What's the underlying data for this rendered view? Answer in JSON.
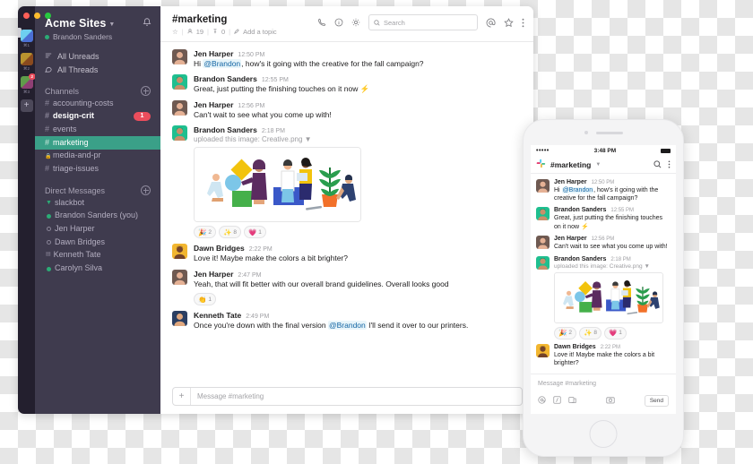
{
  "window": {
    "traffic_lights": [
      "close",
      "minimize",
      "maximize"
    ]
  },
  "rail": {
    "workspaces": [
      {
        "shortcut": "⌘1",
        "color_a": "#6ecff0",
        "color_b": "#4b6fd4",
        "badge": null
      },
      {
        "shortcut": "⌘2",
        "color_a": "#b9932f",
        "color_b": "#8a4a1e",
        "badge": null
      },
      {
        "shortcut": "⌘3",
        "color_a": "#5f9c4a",
        "color_b": "#8f3f74",
        "badge": "2"
      }
    ],
    "add_label": "+"
  },
  "sidebar": {
    "workspace_name": "Acme Sites",
    "user_name": "Brandon Sanders",
    "nav": [
      {
        "label": "All Unreads",
        "icon": "unreads-icon"
      },
      {
        "label": "All Threads",
        "icon": "threads-icon"
      }
    ],
    "channels_header": "Channels",
    "channels": [
      {
        "name": "accounting-costs",
        "symbol": "#",
        "state": "normal",
        "badge": null
      },
      {
        "name": "design-crit",
        "symbol": "#",
        "state": "unread",
        "badge": "1"
      },
      {
        "name": "events",
        "symbol": "#",
        "state": "normal",
        "badge": null
      },
      {
        "name": "marketing",
        "symbol": "#",
        "state": "active",
        "badge": null
      },
      {
        "name": "media-and-pr",
        "symbol": "🔒",
        "state": "normal",
        "badge": null
      },
      {
        "name": "triage-issues",
        "symbol": "#",
        "state": "normal",
        "badge": null
      }
    ],
    "dms_header": "Direct Messages",
    "dms": [
      {
        "name": "slackbot",
        "presence": "bot"
      },
      {
        "name": "Brandon Sanders (you)",
        "presence": "online"
      },
      {
        "name": "Jen Harper",
        "presence": "offline"
      },
      {
        "name": "Dawn Bridges",
        "presence": "offline"
      },
      {
        "name": "Kenneth Tate",
        "presence": "away"
      },
      {
        "name": "Carolyn Silva",
        "presence": "online"
      }
    ]
  },
  "channel_header": {
    "title": "#marketing",
    "star": "☆",
    "members_count": "19",
    "pins_count": "0",
    "add_topic": "Add a topic",
    "search_placeholder": "Search",
    "icons": [
      "phone-icon",
      "info-icon",
      "gear-icon",
      "mentions-icon",
      "star-icon",
      "more-icon"
    ]
  },
  "messages": [
    {
      "author": "Jen Harper",
      "time": "12:50 PM",
      "avatar": "jen",
      "text_pre": "Hi ",
      "mention": "@Brandon",
      "text_post": ", how's it going with the creative for the fall campaign?"
    },
    {
      "author": "Brandon Sanders",
      "time": "12:55 PM",
      "avatar": "brandon",
      "text_pre": "Great, just putting the finishing touches on it now ⚡",
      "mention": "",
      "text_post": ""
    },
    {
      "author": "Jen Harper",
      "time": "12:56 PM",
      "avatar": "jen",
      "text_pre": "Can't wait to see what you come up with!",
      "mention": "",
      "text_post": ""
    },
    {
      "author": "Brandon Sanders",
      "time": "2:18 PM",
      "avatar": "brandon",
      "upload_text": "uploaded this image: Creative.png",
      "attachment": "creative-illustration",
      "reactions": [
        {
          "emoji": "🎉",
          "count": "2"
        },
        {
          "emoji": "✨",
          "count": "8"
        },
        {
          "emoji": "💗",
          "count": "1"
        }
      ]
    },
    {
      "author": "Dawn Bridges",
      "time": "2:22 PM",
      "avatar": "dawn",
      "text_pre": "Love it! Maybe make the colors a bit brighter?",
      "mention": "",
      "text_post": ""
    },
    {
      "author": "Jen Harper",
      "time": "2:47 PM",
      "avatar": "jen",
      "text_pre": "Yeah, that will fit better with our overall brand guidelines. Overall looks good",
      "mention": "",
      "text_post": "",
      "reactions": [
        {
          "emoji": "👏",
          "count": "1"
        }
      ]
    },
    {
      "author": "Kenneth Tate",
      "time": "2:49 PM",
      "avatar": "kenneth",
      "text_pre": "Once you're down with the final version ",
      "mention": "@Brandon",
      "text_post": " I'll send it over to our printers."
    }
  ],
  "composer": {
    "placeholder": "Message #marketing",
    "add_label": "+"
  },
  "phone": {
    "status": {
      "signal": "•••••",
      "time": "3:48 PM",
      "battery": "full"
    },
    "channel": "#marketing",
    "messages": [
      {
        "author": "Jen Harper",
        "time": "12:50 PM",
        "avatar": "jen",
        "text_pre": "Hi ",
        "mention": "@Brandon",
        "text_post": ", how's it going with the creative for the fall campaign?"
      },
      {
        "author": "Brandon Sanders",
        "time": "12:55 PM",
        "avatar": "brandon",
        "text_pre": "Great, just putting the finishing touches on it now ⚡",
        "mention": "",
        "text_post": ""
      },
      {
        "author": "Jen Harper",
        "time": "12:56 PM",
        "avatar": "jen",
        "text_pre": "Can't wait to see what you come up with!",
        "mention": "",
        "text_post": ""
      },
      {
        "author": "Brandon Sanders",
        "time": "2:18 PM",
        "avatar": "brandon",
        "upload_text": "uploaded this image: Creative.png",
        "attachment": "creative-illustration",
        "reactions": [
          {
            "emoji": "🎉",
            "count": "2"
          },
          {
            "emoji": "✨",
            "count": "8"
          },
          {
            "emoji": "💗",
            "count": "1"
          }
        ]
      },
      {
        "author": "Dawn Bridges",
        "time": "2:22 PM",
        "avatar": "dawn",
        "text_pre": "Love it! Maybe make the colors a bit brighter?",
        "mention": "",
        "text_post": ""
      }
    ],
    "composer": {
      "placeholder": "Message #marketing",
      "send_label": "Send",
      "tools": [
        "mention-icon",
        "command-icon",
        "attach-icon",
        "camera-icon"
      ]
    }
  },
  "colors": {
    "sidebar_bg": "#3f3b4e",
    "rail_bg": "#231f2e",
    "active_channel": "#3aa088",
    "badge_red": "#eb4d5c",
    "link_blue": "#1264a3",
    "presence_green": "#2bac76"
  }
}
